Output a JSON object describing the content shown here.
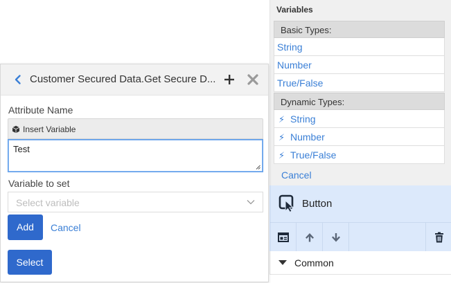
{
  "variables_panel": {
    "title": "Variables",
    "basic_types_header": "Basic Types:",
    "basic_types": [
      {
        "label": "String"
      },
      {
        "label": "Number"
      },
      {
        "label": "True/False"
      }
    ],
    "dynamic_types_header": "Dynamic Types:",
    "dynamic_types": [
      {
        "label": "String",
        "icon": "lightning-icon"
      },
      {
        "label": "Number",
        "icon": "lightning-icon"
      },
      {
        "label": "True/False",
        "icon": "lightning-icon"
      }
    ],
    "cancel_label": "Cancel"
  },
  "component": {
    "name": "Button",
    "icon": "cursor-pointer-icon",
    "toolbar": {
      "buttons": [
        "layout-icon",
        "arrow-up-icon",
        "arrow-down-icon",
        "trash-icon"
      ]
    },
    "section": {
      "label": "Common",
      "icon": "caret-down-icon"
    }
  },
  "dialog": {
    "title": "Customer Secured Data.Get Secure D...",
    "attribute_name_label": "Attribute Name",
    "insert_variable_label": "Insert Variable",
    "attribute_value": "Test",
    "variable_to_set_label": "Variable to set",
    "variable_placeholder": "Select variable",
    "add_label": "Add",
    "cancel_label": "Cancel",
    "select_label": "Select"
  },
  "colors": {
    "accent_blue": "#2f69cc",
    "link_blue": "#3a7fd6",
    "selected_panel_bg": "#dce9fb"
  }
}
